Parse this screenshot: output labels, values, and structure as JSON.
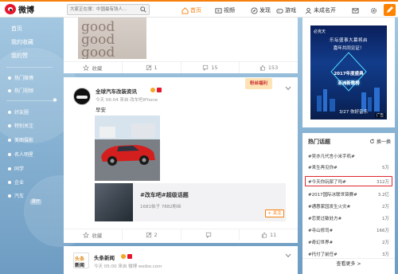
{
  "header": {
    "logo_text": "微博",
    "search_placeholder": "大家正在搜：中国最有钱人...",
    "nav": {
      "home": "首页",
      "video": "视频",
      "discover": "发现",
      "game": "游戏",
      "user": "未成名开"
    }
  },
  "sidebar": {
    "items": [
      "首页",
      "我的收藏",
      "我的赞"
    ],
    "sections": [
      "热门微博",
      "热门视频"
    ],
    "groups": [
      "好友圈",
      "特别关注",
      "美图摄影",
      "名人明星",
      "同学",
      "企业",
      "汽车"
    ],
    "more": "展开"
  },
  "feed": {
    "post1": {
      "image_words": [
        "good",
        "good",
        "good"
      ],
      "actions": {
        "favorite": "收藏",
        "repost": "1",
        "comment": "15",
        "like": "153"
      }
    },
    "post2": {
      "user": "全球汽车改装资讯",
      "meta": "今天 06:04 来自 改车吧iPhone",
      "text": "早安",
      "promo": "粉丝福利",
      "topic": {
        "title": "#改车吧#超级话题",
        "stats": "1681帖子 7882粉丝",
        "follow": "+ 关注"
      },
      "actions": {
        "favorite": "收藏",
        "repost": "2",
        "comment": "",
        "like": "11"
      }
    },
    "post3": {
      "user": "头条新闻",
      "meta": "今天 05:00 来自 微博 weibo.com",
      "avatar_text": [
        "头条",
        "新闻"
      ]
    }
  },
  "ad": {
    "logo": "必克天",
    "line1": "乐坛盛事大幕将启",
    "line2": "嘉年共同见证！",
    "big1": "2017年度盛典",
    "big2": "亚洲新歌榜",
    "date": "3/27 你好音乐",
    "tag": "广告"
  },
  "hot_topics": {
    "title": "热门话题",
    "refresh": "换一换",
    "rows": [
      {
        "keyword": "#吴亦凡代言小米手机#",
        "count": ""
      },
      {
        "keyword": "#来生再见你#",
        "count": "5万"
      },
      {
        "keyword": "#今天你玩尿了吗#",
        "count": "312万"
      },
      {
        "keyword": "#2017国际冰联世锦赛#",
        "count": "3.2亿"
      },
      {
        "keyword": "#通惠家园发生火灾#",
        "count": "2万"
      },
      {
        "keyword": "#恋爱过敏处方#",
        "count": "1万"
      },
      {
        "keyword": "#寺山修司#",
        "count": "166万"
      },
      {
        "keyword": "#奇幻世界#",
        "count": "2万"
      },
      {
        "keyword": "#托付了前任#",
        "count": "3万"
      }
    ],
    "more": "查看更多 >"
  },
  "colors": {
    "accent": "#f77f0d",
    "highlight_border": "#e0262e"
  }
}
